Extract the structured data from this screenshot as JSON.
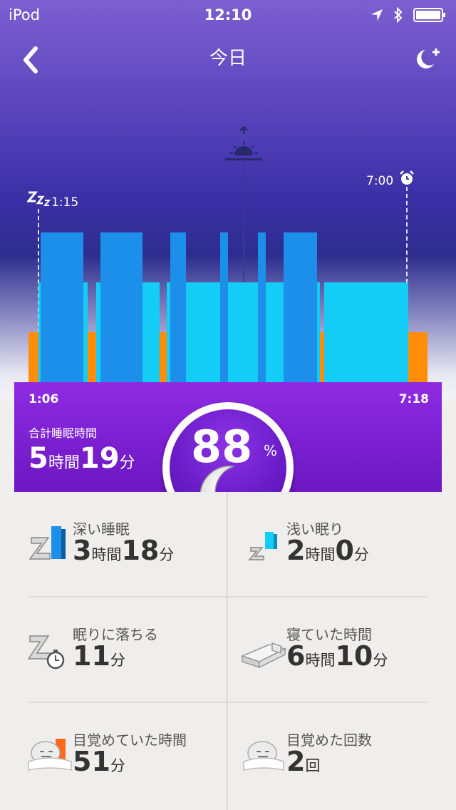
{
  "status_bar": {
    "carrier": "iPod",
    "time": "12:10"
  },
  "nav": {
    "title": "今日"
  },
  "chart_labels": {
    "asleep_time": "1:15",
    "alarm_time": "7:00"
  },
  "chart_data": {
    "type": "bar",
    "x_unit": "time",
    "phases": [
      "awake",
      "light",
      "deep"
    ],
    "colors": {
      "deep": "#1b8fe9",
      "light": "#13cdf7",
      "awake": "#ff8d06"
    },
    "segments": [
      {
        "start": "1:06",
        "end": "1:15",
        "phase": "awake"
      },
      {
        "start": "1:15",
        "end": "1:17",
        "phase": "light"
      },
      {
        "start": "1:17",
        "end": "1:57",
        "phase": "deep"
      },
      {
        "start": "1:57",
        "end": "2:01",
        "phase": "light"
      },
      {
        "start": "2:01",
        "end": "2:09",
        "phase": "awake"
      },
      {
        "start": "2:09",
        "end": "2:13",
        "phase": "light"
      },
      {
        "start": "2:13",
        "end": "2:52",
        "phase": "deep"
      },
      {
        "start": "2:52",
        "end": "3:08",
        "phase": "light"
      },
      {
        "start": "3:08",
        "end": "3:15",
        "phase": "awake"
      },
      {
        "start": "3:15",
        "end": "3:18",
        "phase": "light"
      },
      {
        "start": "3:18",
        "end": "3:33",
        "phase": "deep"
      },
      {
        "start": "3:33",
        "end": "4:05",
        "phase": "light"
      },
      {
        "start": "4:05",
        "end": "4:12",
        "phase": "deep"
      },
      {
        "start": "4:12",
        "end": "4:40",
        "phase": "light"
      },
      {
        "start": "4:40",
        "end": "4:47",
        "phase": "deep"
      },
      {
        "start": "4:47",
        "end": "5:04",
        "phase": "light"
      },
      {
        "start": "5:04",
        "end": "5:35",
        "phase": "deep"
      },
      {
        "start": "5:35",
        "end": "5:38",
        "phase": "light"
      },
      {
        "start": "5:38",
        "end": "5:42",
        "phase": "awake"
      },
      {
        "start": "5:42",
        "end": "6:54",
        "phase": "light"
      },
      {
        "start": "6:54",
        "end": "7:00",
        "phase": "light"
      },
      {
        "start": "7:00",
        "end": "7:18",
        "phase": "awake"
      }
    ]
  },
  "panel": {
    "start_time": "1:06",
    "end_time": "7:18",
    "total_label": "合計睡眠時間",
    "total_hours": "5",
    "hours_unit": "時間",
    "total_minutes": "19",
    "minutes_unit": "分",
    "score": "88",
    "score_unit": "%"
  },
  "stats": [
    {
      "label": "深い睡眠",
      "v1": "3",
      "u1": "時間",
      "v2": "18",
      "u2": "分",
      "icon": "deep-sleep-icon"
    },
    {
      "label": "浅い眠り",
      "v1": "2",
      "u1": "時間",
      "v2": "0",
      "u2": "分",
      "icon": "light-sleep-icon"
    },
    {
      "label": "眠りに落ちる",
      "v1": "11",
      "u1": "分",
      "v2": "",
      "u2": "",
      "icon": "fall-asleep-icon"
    },
    {
      "label": "寝ていた時間",
      "v1": "6",
      "u1": "時間",
      "v2": "10",
      "u2": "分",
      "icon": "bed-icon"
    },
    {
      "label": "目覚めていた時間",
      "v1": "51",
      "u1": "分",
      "v2": "",
      "u2": "",
      "icon": "awake-time-icon"
    },
    {
      "label": "目覚めた回数",
      "v1": "2",
      "u1": "回",
      "v2": "",
      "u2": "",
      "icon": "times-woken-icon"
    }
  ]
}
